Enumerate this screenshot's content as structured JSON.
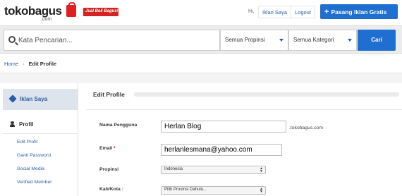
{
  "header": {
    "logo_text": "tokobagus",
    "logo_sub": ".com",
    "tagline": "Jual Beli Bagus!",
    "greeting": "Hi,",
    "iklan_saya": "Iklan Saya",
    "logout": "Logout",
    "pasang_plus": "+",
    "pasang_label": "Pasang Iklan Gratis"
  },
  "search": {
    "placeholder": "Kata Pencarian...",
    "province": "Semua Propinsi",
    "category": "Semua Kategori",
    "button": "Cari"
  },
  "breadcrumb": {
    "home": "Home",
    "separator": "›",
    "current": "Edit Profile"
  },
  "sidebar": {
    "section": "Iklan Saya",
    "profile_heading": "Profil",
    "links": [
      "Edit Profil",
      "Ganti Password",
      "Social Media",
      "Verified Member"
    ]
  },
  "main": {
    "title": "Edit Profile",
    "fields": {
      "username_label": "Nama Pengguna",
      "username_value": "Herlan Blog",
      "username_suffix": ".tokobagus.com",
      "email_label": "Email",
      "email_required": "*",
      "email_value": "herlanlesmana@yahoo.com",
      "province_label": "Propinsi",
      "province_value": "Indonesia",
      "city_label": "Kab/Kota :",
      "city_value": "Pilih Provinsi Dahulu..."
    }
  },
  "colors": {
    "brand_red": "#d42222",
    "brand_blue": "#1f6fd1",
    "link_blue": "#2a5ea8"
  }
}
